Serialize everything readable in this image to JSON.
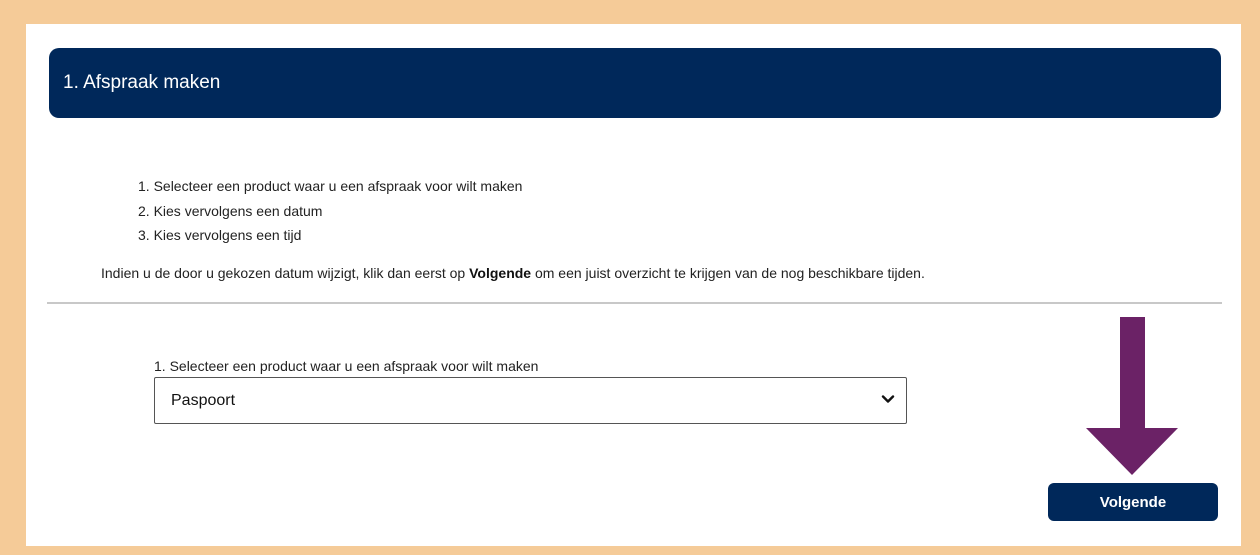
{
  "header": {
    "title": "1. Afspraak maken"
  },
  "instructions": {
    "steps": [
      "1. Selecteer een product waar u een afspraak voor wilt maken",
      "2. Kies vervolgens een datum",
      "3. Kies vervolgens een tijd"
    ],
    "note_prefix": "Indien u de door u gekozen datum wijzigt, klik dan eerst op ",
    "note_bold": "Volgende",
    "note_suffix": " om een juist overzicht te krijgen van de nog beschikbare tijden."
  },
  "product_select": {
    "label": "1. Selecteer een product waar u een afspraak voor wilt maken",
    "selected_value": "Paspoort",
    "icon": "chevron-down-icon"
  },
  "annotation": {
    "icon": "arrow-down-icon",
    "color": "#6b2266"
  },
  "actions": {
    "next_label": "Volgende"
  },
  "colors": {
    "background": "#f5cb98",
    "header": "#00285a",
    "button": "#00285a",
    "arrow": "#6b2266"
  }
}
